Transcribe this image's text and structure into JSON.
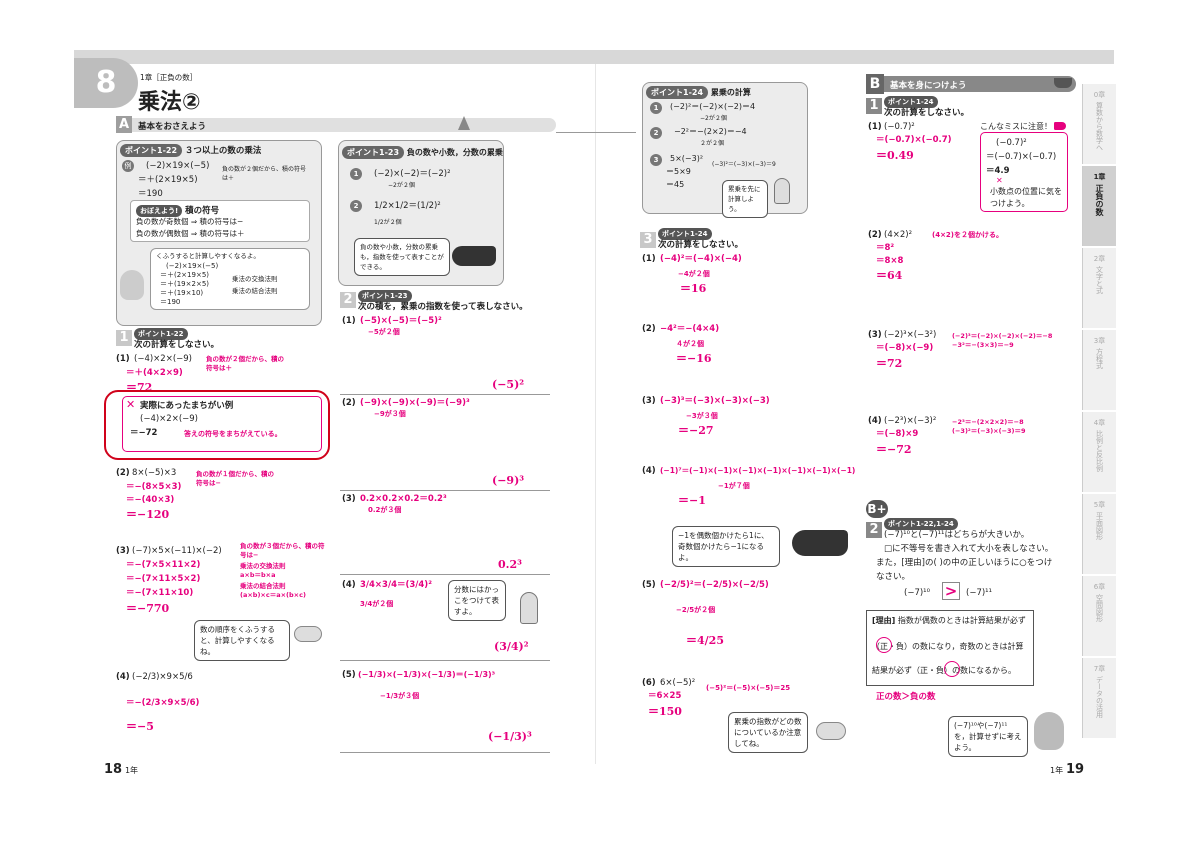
{
  "header": {
    "section_number": "8",
    "chapter_label": "1章［正負の数］",
    "title": "乗法②",
    "section_a": "基本をおさえよう",
    "section_b": "基本を身につけよう"
  },
  "point_1_22": {
    "tag": "ポイント1-22",
    "heading": "３つ以上の数の乗法",
    "example_label": "例",
    "lines": [
      "(−2)×19×(−5)",
      "＝＋(2×19×5)",
      "＝190"
    ],
    "note": "負の数が２個だから、積の符号は＋",
    "remember_tag": "おぼえよう!",
    "remember_title": "積の符号",
    "rule1": "負の数が偶数個 ⇒ 積の符号は＋",
    "rule2": "負の数が奇数個 ⇒ 積の符号は−",
    "bubble": "くふうすると計算しやすくなるよ。",
    "calc": [
      "(−2)×19×(−5)",
      "＝＋(2×19×5)",
      "＝＋(19×2×5)",
      "＝＋(19×10)",
      "＝190"
    ],
    "calc_notes": [
      "乗法の交換法則",
      "乗法の結合法則"
    ]
  },
  "point_1_23": {
    "tag": "ポイント1-23",
    "heading": "負の数や小数，分数の累乗",
    "ex1": "(−2)×(−2)＝(−2)²",
    "ex1_note": "−2が２個",
    "ex2": "1/2×1/2＝(1/2)²",
    "ex2_note": "1/2が２個",
    "bubble": "負の数や小数，分数の累乗も，指数を使って表すことができる。"
  },
  "point_1_24": {
    "tag": "ポイント1-24",
    "heading": "累乗の計算",
    "ex1": "(−2)²＝(−2)×(−2)＝4",
    "ex1_note": "−2が２個",
    "ex2": "−2²＝−(2×2)＝−4",
    "ex2_note": "２が２個",
    "ex3_lines": [
      "5×(−3)²",
      "＝5×9",
      "＝45"
    ],
    "ex3_note": "(−3)²＝(−3)×(−3)＝9",
    "bubble": "累乗を先に計算しよう。"
  },
  "q1": {
    "num": "1",
    "tag": "ポイント1-22",
    "instruction": "次の計算をしなさい。",
    "p1": {
      "label": "(1)",
      "expr": "(−4)×2×(−9)",
      "step": "＝＋(4×2×9)",
      "answer": "＝72",
      "note": "負の数が２個だから、積の符号は＋"
    },
    "mistake_title": "実際にあったまちがい例",
    "mistake_expr": "(−4)×2×(−9)",
    "mistake_answer": "＝−72",
    "mistake_note": "答えの符号をまちがえている。",
    "p2": {
      "label": "(2)",
      "expr": "8×(−5)×3",
      "steps": [
        "＝−(8×5×3)",
        "＝−(40×3)"
      ],
      "answer": "＝−120",
      "note": "負の数が１個だから、積の符号は−"
    },
    "p3": {
      "label": "(3)",
      "expr": "(−7)×5×(−11)×(−2)",
      "steps": [
        "＝−(7×5×11×2)",
        "＝−(7×11×5×2)",
        "＝−(7×11×10)"
      ],
      "answer": "＝−770",
      "notes": [
        "負の数が３個だから、積の符号は−",
        "乗法の交換法則",
        "a×b＝b×a",
        "乗法の結合法則",
        "(a×b)×c＝a×(b×c)"
      ]
    },
    "bubble": "数の順序をくふうすると、計算しやすくなるね。",
    "p4": {
      "label": "(4)",
      "expr": "(−2/3)×9×5/6",
      "step": "＝−(2/3×9×5/6)",
      "answer": "＝−5"
    }
  },
  "q2": {
    "num": "2",
    "tag": "ポイント1-23",
    "instruction": "次の積を，累乗の指数を使って表しなさい。",
    "items": [
      {
        "label": "(1)",
        "expr": "(−5)×(−5)＝(−5)²",
        "note": "−5が２個",
        "answer": "(−5)²"
      },
      {
        "label": "(2)",
        "expr": "(−9)×(−9)×(−9)＝(−9)³",
        "note": "−9が３個",
        "answer": "(−9)³"
      },
      {
        "label": "(3)",
        "expr": "0.2×0.2×0.2＝0.2³",
        "note": "0.2が３個",
        "answer": "0.2³"
      },
      {
        "label": "(4)",
        "expr": "3/4×3/4＝(3/4)²",
        "note": "3/4が２個",
        "answer": "(3/4)²"
      },
      {
        "label": "(5)",
        "expr": "(−1/3)×(−1/3)×(−1/3)＝(−1/3)³",
        "note": "−1/3が３個",
        "answer": "(−1/3)³"
      }
    ],
    "bubble": "分数にはかっこをつけて表すよ。"
  },
  "q3": {
    "num": "3",
    "tag": "ポイント1-24",
    "instruction": "次の計算をしなさい。",
    "items": [
      {
        "label": "(1)",
        "expr": "(−4)²＝(−4)×(−4)",
        "note": "−4が２個",
        "answer": "＝16"
      },
      {
        "label": "(2)",
        "expr": "−4²＝−(4×4)",
        "note": "４が２個",
        "answer": "＝−16"
      },
      {
        "label": "(3)",
        "expr": "(−3)³＝(−3)×(−3)×(−3)",
        "note": "−3が３個",
        "answer": "＝−27"
      },
      {
        "label": "(4)",
        "expr": "(−1)⁷＝(−1)×(−1)×(−1)×(−1)×(−1)×(−1)×(−1)",
        "note": "−1が７個",
        "answer": "＝−1"
      },
      {
        "label": "(5)",
        "expr": "(−2/5)²＝(−2/5)×(−2/5)",
        "note": "−2/5が２個",
        "answer": "＝4/25"
      },
      {
        "label": "(6)",
        "expr": "6×(−5)²",
        "step": "＝6×25",
        "note": "(−5)²＝(−5)×(−5)＝25",
        "answer": "＝150"
      }
    ],
    "bubble1": "−1を偶数個かけたら1に、奇数個かけたら−1になるよ。",
    "bubble2": "累乗の指数がどの数についているか注意してね。"
  },
  "b1": {
    "num": "1",
    "tag": "ポイント1-24",
    "instruction": "次の計算をしなさい。",
    "p1": {
      "label": "(1)",
      "expr": "(−0.7)²",
      "step": "＝(−0.7)×(−0.7)",
      "answer": "＝0.49"
    },
    "caution_title": "こんなミスに注意！",
    "caution_lines": [
      "(−0.7)²",
      "＝(−0.7)×(−0.7)",
      "＝4.9"
    ],
    "caution_note": "小数点の位置に気をつけよう。",
    "p2": {
      "label": "(2)",
      "expr": "(4×2)²",
      "note": "(4×2)を２個かける。",
      "steps": [
        "＝8²",
        "＝8×8"
      ],
      "answer": "＝64"
    },
    "p3": {
      "label": "(3)",
      "expr": "(−2)³×(−3²)",
      "step": "＝(−8)×(−9)",
      "answer": "＝72",
      "notes": [
        "(−2)³＝(−2)×(−2)×(−2)＝−8",
        "−3²＝−(3×3)＝−9"
      ]
    },
    "p4": {
      "label": "(4)",
      "expr": "(−2³)×(−3)²",
      "step": "＝(−8)×9",
      "answer": "＝−72",
      "notes": [
        "−2³＝−(2×2×2)＝−8",
        "(−3)²＝(−3)×(−3)＝9"
      ]
    }
  },
  "b2": {
    "num": "2",
    "tag": "ポイント1-22,1-24",
    "instruction1": "(−7)¹⁰と(−7)¹¹はどちらが大きいか。",
    "instruction2": "□に不等号を書き入れて大小を表しなさい。",
    "instruction3": "また，[理由]の( )の中の正しいほうに○をつけなさい。",
    "compare_left": "(−7)¹⁰",
    "compare_sign": ">",
    "compare_right": "(−7)¹¹",
    "reason_label": "[理由]",
    "reason1": "指数が偶数のときは計算結果が必ず",
    "reason2": "（正・負）の数になり，奇数のときは計算",
    "reason3": "結果が必ず（正・負）の数になるから。",
    "conclusion": "正の数＞負の数",
    "bubble": "(−7)¹⁰や(−7)¹¹を，計算せずに考えよう。"
  },
  "footer": {
    "left_page": "18",
    "left_grade": "1年",
    "right_grade": "1年",
    "right_page": "19"
  },
  "sidetabs": [
    {
      "ch": "0章",
      "name": "算数から数学へ"
    },
    {
      "ch": "1章",
      "name": "正負の数"
    },
    {
      "ch": "2章",
      "name": "文字と式"
    },
    {
      "ch": "3章",
      "name": "方程式"
    },
    {
      "ch": "4章",
      "name": "比例と反比例"
    },
    {
      "ch": "5章",
      "name": "平面図形"
    },
    {
      "ch": "6章",
      "name": "空間図形"
    },
    {
      "ch": "7章",
      "name": "データの活用"
    }
  ],
  "colors": {
    "accent": "#e6007e",
    "gray": "#888888",
    "box": "#ececec",
    "mistake_border": "#d0021b"
  }
}
